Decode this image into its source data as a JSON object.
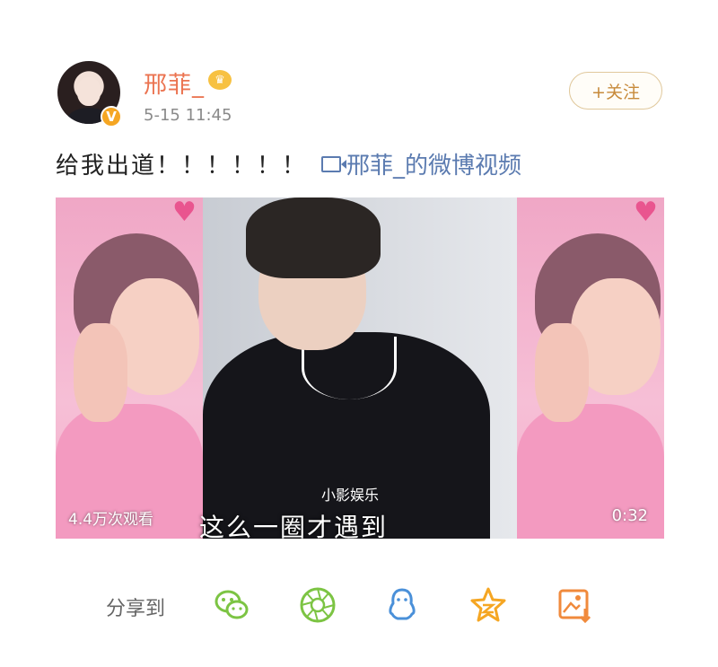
{
  "post": {
    "username": "邢菲_",
    "time": "5-15 11:45",
    "follow_label": "+关注",
    "text": "给我出道！！！！！！",
    "video_link": "邢菲_的微博视频"
  },
  "video": {
    "views": "4.4万次观看",
    "duration": "0:32",
    "watermark": "小影娱乐",
    "subtitle": "这么一圈才遇到"
  },
  "share": {
    "label": "分享到",
    "targets": [
      "wechat-icon",
      "moments-icon",
      "qq-icon",
      "qzone-icon",
      "save-image-icon"
    ]
  },
  "colors": {
    "username": "#eb7350",
    "link": "#5b7bb0",
    "follow_border": "#e0c89c",
    "icon_green": "#7cc443",
    "icon_blue": "#4a90d9",
    "icon_gold": "#f5a623",
    "icon_orange": "#f08a3c"
  }
}
